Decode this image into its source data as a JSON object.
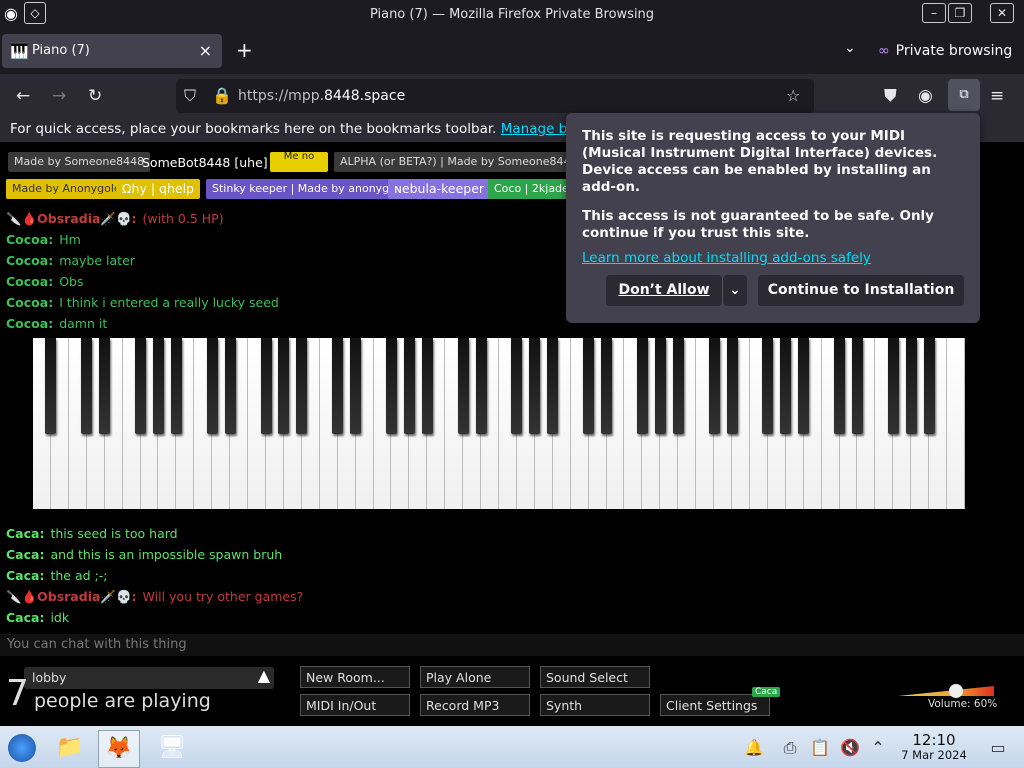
{
  "window": {
    "title": "Piano (7) — Mozilla Firefox Private Browsing"
  },
  "tabs": [
    {
      "label": "Piano (7)"
    }
  ],
  "private_label": "Private browsing",
  "url": {
    "prefix": "https://mpp.",
    "domain": "8448.space"
  },
  "bookmarks": {
    "text": "For quick access, place your bookmarks here on the bookmarks toolbar.",
    "link": "Manage bo"
  },
  "tags": {
    "row1": [
      "Made by Someone8448",
      "SomeBot8448 [uhe]",
      "Me no",
      "ALPHA (or BETA?) | Made by Someone8448"
    ],
    "row2": [
      "Made by Anonygold",
      "Ωhy | qhelp",
      "Stinky keeper | Made by anonygirl",
      "ɴebula-keeper",
      "Coco | 2kjade"
    ]
  },
  "chat": [
    {
      "name": "🔪🩸Obsradia🗡️💀:",
      "text": "(with 0.5 HP)",
      "color": "#c43b3b"
    },
    {
      "name": "Cocoa:",
      "text": "Hm",
      "color": "#3fbf5a"
    },
    {
      "name": "Cocoa:",
      "text": "maybe later",
      "color": "#3fbf5a"
    },
    {
      "name": "Cocoa:",
      "text": "Obs",
      "color": "#3fbf5a"
    },
    {
      "name": "Cocoa:",
      "text": "I think i entered a really lucky seed",
      "color": "#3fbf5a"
    },
    {
      "name": "Cocoa:",
      "text": "damn it",
      "color": "#3fbf5a"
    },
    {
      "name": "Caca:",
      "text": "this seed is too hard",
      "color": "#5fe06e"
    },
    {
      "name": "Caca:",
      "text": "and this is an impossible spawn bruh",
      "color": "#5fe06e"
    },
    {
      "name": "Caca:",
      "text": "the ad ;-;",
      "color": "#5fe06e"
    },
    {
      "name": "🔪🩸Obsradia🗡️💀:",
      "text": "Will you try other games?",
      "color": "#c43b3b"
    },
    {
      "name": "Caca:",
      "text": "idk",
      "color": "#5fe06e"
    }
  ],
  "popup": {
    "line1": "This site is requesting access to your MIDI (Musical Instrument Digital Interface) devices. Device access can be enabled by installing an add-on.",
    "line2": "This access is not guaranteed to be safe. Only continue if you trust this site.",
    "link": "Learn more about installing add-ons safely",
    "deny": "Don’t Allow",
    "allow": "Continue to Installation"
  },
  "chat_placeholder": "You can chat with this thing",
  "room": {
    "name": "lobby",
    "count": "7",
    "label": "people are playing"
  },
  "buttons": [
    "New Room...",
    "Play Alone",
    "Sound Select",
    "MIDI In/Out",
    "Record MP3",
    "Synth",
    "Client Settings"
  ],
  "user_badge": "Caca",
  "volume": {
    "label": "Volume: 60%",
    "value": 0.6
  },
  "clock": {
    "time": "12:10",
    "date": "7 Mar 2024"
  }
}
